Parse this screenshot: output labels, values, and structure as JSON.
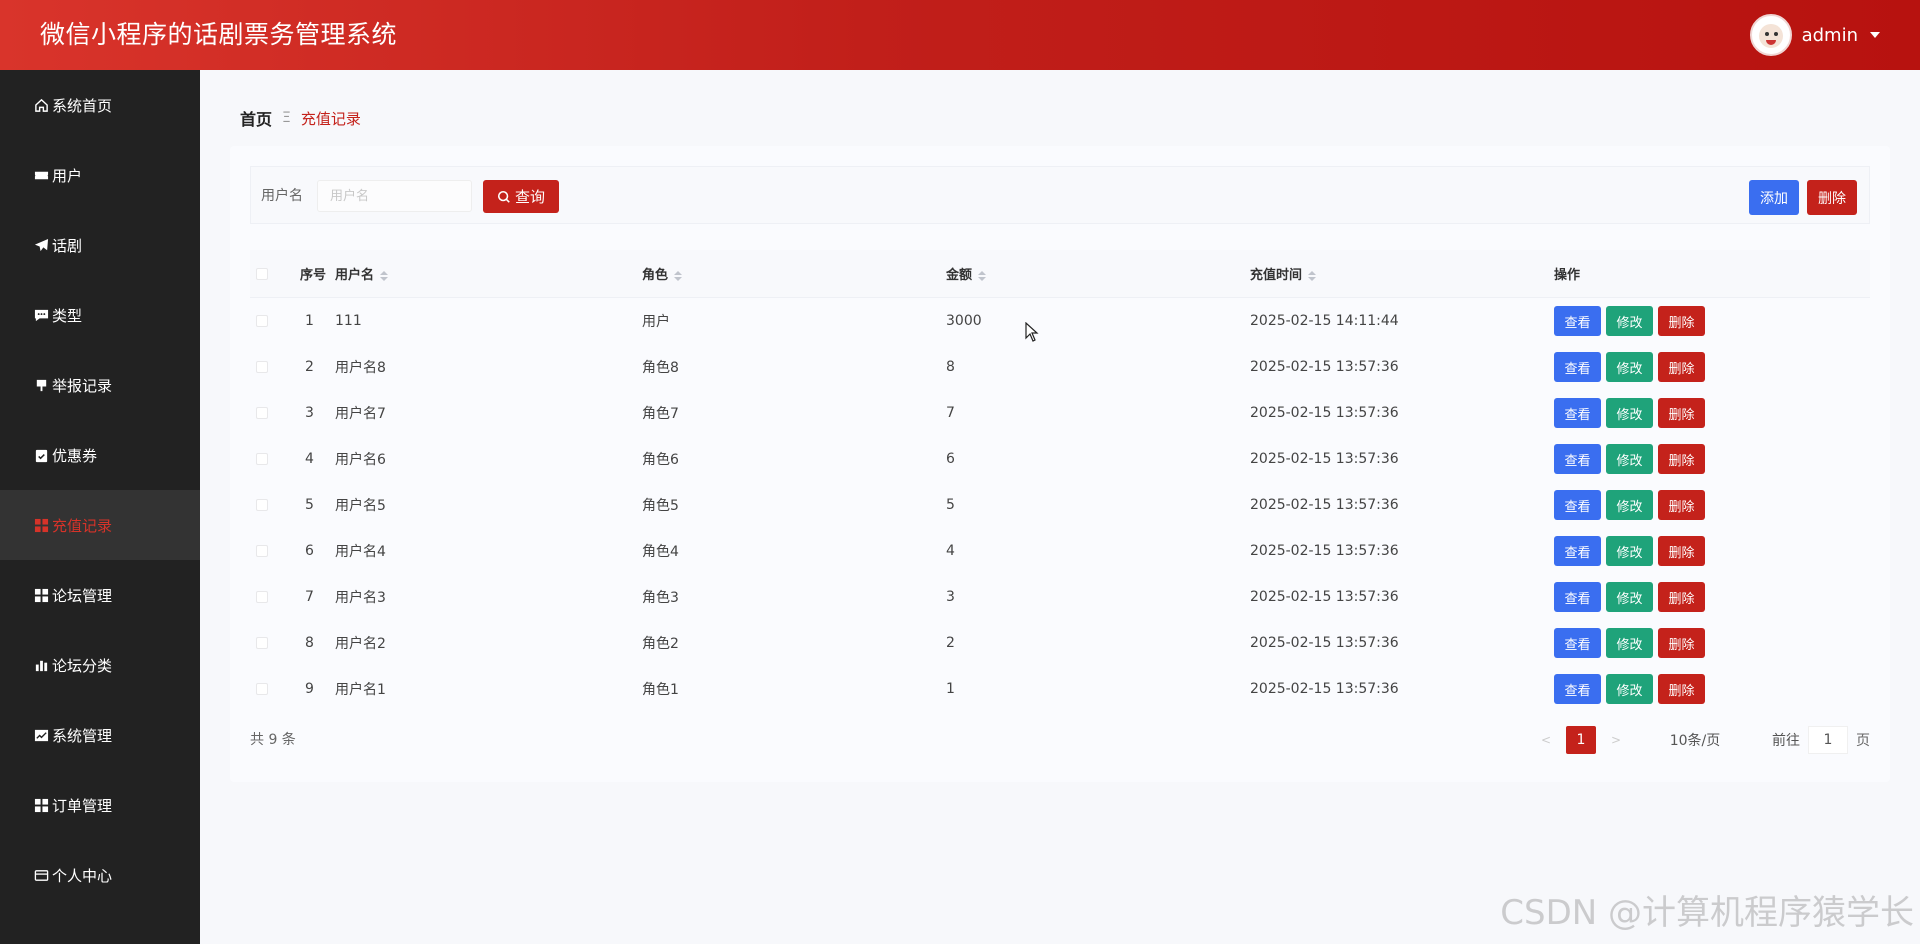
{
  "header": {
    "title": "微信小程序的话剧票务管理系统",
    "user": "admin"
  },
  "sidebar": {
    "items": [
      {
        "label": "系统首页",
        "icon": "home-icon"
      },
      {
        "label": "用户",
        "icon": "ticket-icon"
      },
      {
        "label": "话剧",
        "icon": "send-icon"
      },
      {
        "label": "类型",
        "icon": "comment-icon"
      },
      {
        "label": "举报记录",
        "icon": "flag-icon"
      },
      {
        "label": "优惠券",
        "icon": "clipboard-icon"
      },
      {
        "label": "充值记录",
        "icon": "grid-icon",
        "active": true
      },
      {
        "label": "论坛管理",
        "icon": "grid-icon"
      },
      {
        "label": "论坛分类",
        "icon": "bar-chart-icon"
      },
      {
        "label": "系统管理",
        "icon": "line-chart-icon"
      },
      {
        "label": "订单管理",
        "icon": "grid-icon"
      },
      {
        "label": "个人中心",
        "icon": "card-icon"
      }
    ]
  },
  "breadcrumb": {
    "home": "首页",
    "separator": "Ξ",
    "current": "充值记录"
  },
  "search": {
    "label": "用户名",
    "placeholder": "用户名",
    "value": "",
    "query_label": "查询",
    "add_label": "添加",
    "delete_label": "删除"
  },
  "table": {
    "headers": {
      "index": "序号",
      "username": "用户名",
      "role": "角色",
      "amount": "金额",
      "time": "充值时间",
      "ops": "操作"
    },
    "op_labels": {
      "view": "查看",
      "edit": "修改",
      "delete": "删除"
    },
    "rows": [
      {
        "index": "1",
        "username": "111",
        "role": "用户",
        "amount": "3000",
        "time": "2025-02-15 14:11:44"
      },
      {
        "index": "2",
        "username": "用户名8",
        "role": "角色8",
        "amount": "8",
        "time": "2025-02-15 13:57:36"
      },
      {
        "index": "3",
        "username": "用户名7",
        "role": "角色7",
        "amount": "7",
        "time": "2025-02-15 13:57:36"
      },
      {
        "index": "4",
        "username": "用户名6",
        "role": "角色6",
        "amount": "6",
        "time": "2025-02-15 13:57:36"
      },
      {
        "index": "5",
        "username": "用户名5",
        "role": "角色5",
        "amount": "5",
        "time": "2025-02-15 13:57:36"
      },
      {
        "index": "6",
        "username": "用户名4",
        "role": "角色4",
        "amount": "4",
        "time": "2025-02-15 13:57:36"
      },
      {
        "index": "7",
        "username": "用户名3",
        "role": "角色3",
        "amount": "3",
        "time": "2025-02-15 13:57:36"
      },
      {
        "index": "8",
        "username": "用户名2",
        "role": "角色2",
        "amount": "2",
        "time": "2025-02-15 13:57:36"
      },
      {
        "index": "9",
        "username": "用户名1",
        "role": "角色1",
        "amount": "1",
        "time": "2025-02-15 13:57:36"
      }
    ]
  },
  "pagination": {
    "total": "共 9 条",
    "current_page": "1",
    "page_size": "10条/页",
    "goto_prefix": "前往",
    "goto_value": "1",
    "goto_suffix": "页"
  },
  "watermark": "CSDN @计算机程序猿学长",
  "colors": {
    "header": "#c11f1a",
    "sidebar": "#222222",
    "primary_red": "#c4221b",
    "blue": "#3a6ef0",
    "green": "#1fa37a"
  }
}
